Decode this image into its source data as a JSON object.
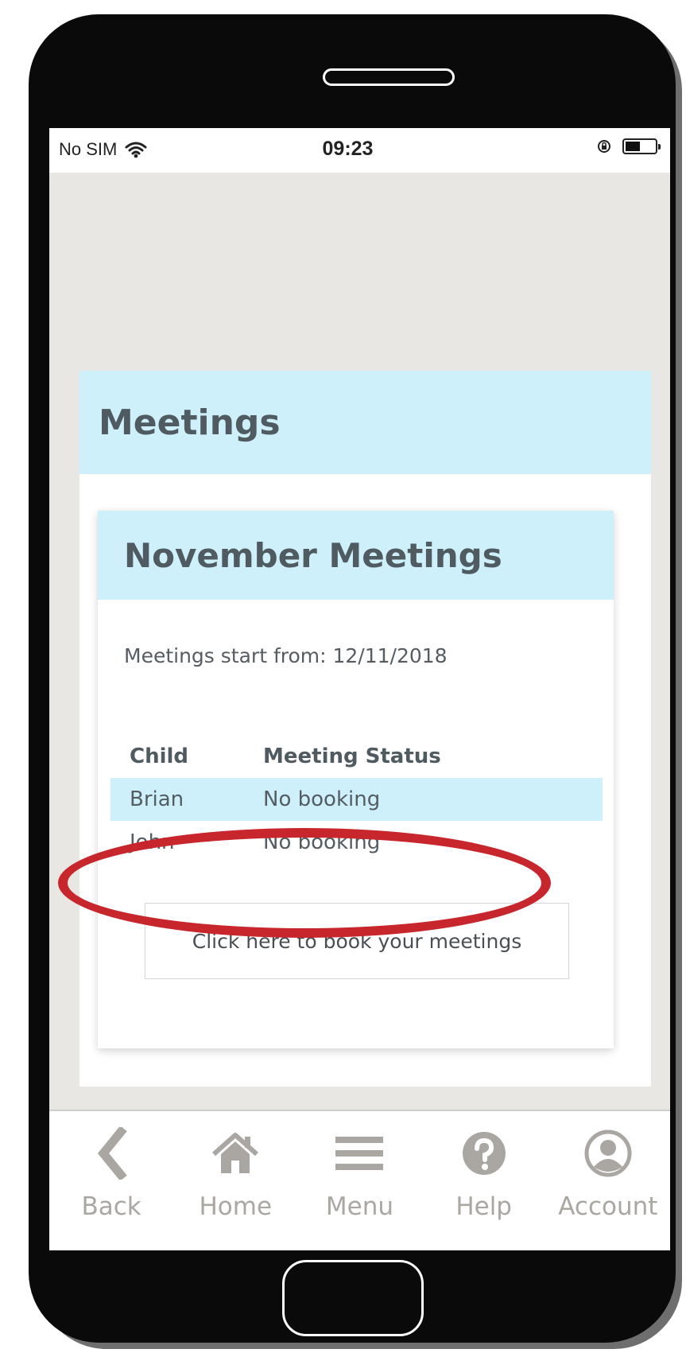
{
  "status_bar": {
    "carrier": "No SIM",
    "time": "09:23"
  },
  "page": {
    "title": "Meetings"
  },
  "card": {
    "title": "November Meetings",
    "start_text": "Meetings start from: 12/11/2018",
    "columns": [
      "Child",
      "Meeting Status"
    ],
    "rows": [
      {
        "child": "Brian",
        "status": "No booking"
      },
      {
        "child": "John",
        "status": "No booking"
      }
    ],
    "book_button_label": "Click here to book your meetings"
  },
  "nav": {
    "items": [
      {
        "label": "Back",
        "icon": "chevron-left-icon"
      },
      {
        "label": "Home",
        "icon": "house-icon"
      },
      {
        "label": "Menu",
        "icon": "hamburger-icon"
      },
      {
        "label": "Help",
        "icon": "question-icon"
      },
      {
        "label": "Account",
        "icon": "user-icon"
      }
    ]
  },
  "colors": {
    "panel_header": "#cdf0fb",
    "highlight": "#c8262d",
    "nav_icon": "#aaa7a2"
  }
}
